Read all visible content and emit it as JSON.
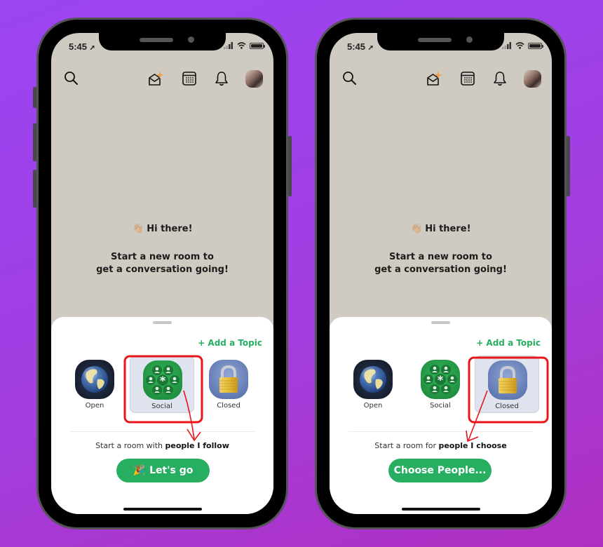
{
  "phones": [
    {
      "status": {
        "time": "5:45"
      },
      "greeting": {
        "emoji": "👋🏼",
        "text": "Hi there!"
      },
      "prompt": {
        "line1": "Start a new room to",
        "line2": "get a conversation going!"
      },
      "sheet": {
        "add_topic": "+ Add a Topic",
        "room_types": [
          {
            "label": "Open",
            "icon": "globe-icon",
            "selected": false
          },
          {
            "label": "Social",
            "icon": "social-group-icon",
            "selected": true
          },
          {
            "label": "Closed",
            "icon": "padlock-icon",
            "selected": false
          }
        ],
        "description_prefix": "Start a room with ",
        "description_bold": "people I follow",
        "cta_emoji": "🎉",
        "cta_label": "Let's go"
      }
    },
    {
      "status": {
        "time": "5:45"
      },
      "greeting": {
        "emoji": "👋🏼",
        "text": "Hi there!"
      },
      "prompt": {
        "line1": "Start a new room to",
        "line2": "get a conversation going!"
      },
      "sheet": {
        "add_topic": "+ Add a Topic",
        "room_types": [
          {
            "label": "Open",
            "icon": "globe-icon",
            "selected": false
          },
          {
            "label": "Social",
            "icon": "social-group-icon",
            "selected": false
          },
          {
            "label": "Closed",
            "icon": "padlock-icon",
            "selected": true
          }
        ],
        "description_prefix": "Start a room for ",
        "description_bold": "people I choose",
        "cta_label": "Choose People..."
      }
    }
  ],
  "colors": {
    "accent_green": "#27ae60",
    "screen_bg": "#cfcbc3",
    "annotation_red": "#e8151b",
    "selected_bg": "#dfe3ed"
  }
}
